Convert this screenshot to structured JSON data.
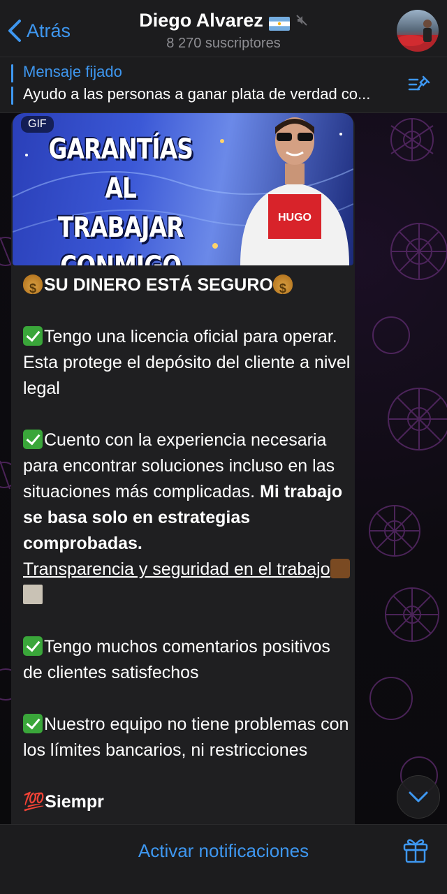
{
  "header": {
    "back_label": "Atrás",
    "channel_name": "Diego Alvarez",
    "subscribers": "8 270 suscriptores"
  },
  "pinned": {
    "title": "Mensaje fijado",
    "text": "Ayudo a las personas a ganar plata de verdad co..."
  },
  "message": {
    "media_badge": "GIF",
    "banner_lines": [
      "GARANTÍAS",
      "AL TRABAJAR",
      "CONMIGO"
    ],
    "shirt_brand": "HUGO",
    "heading": "SU DINERO ESTÁ SEGURO",
    "p1": "Tengo una licencia oficial para operar. Esta protege el depósito del cliente a nivel legal",
    "p2_plain": "Cuento con la experiencia necesaria para encontrar soluciones incluso en las situaciones más complicadas. ",
    "p2_bold": "Mi trabajo se basa solo en estrategias comprobadas.",
    "p2_underline": "Transparencia y seguridad en el trabajo",
    "p3": "Tengo muchos comentarios positivos de clientes satisfechos",
    "p4": "Nuestro equipo no tiene problemas con los límites bancarios, ni restricciones",
    "p5_partial": "Siempr"
  },
  "bottom": {
    "activate_label": "Activar notificaciones"
  },
  "colors": {
    "accent": "#3e97f0",
    "bubble": "#1f1f21",
    "bar": "#1c1c1e"
  }
}
